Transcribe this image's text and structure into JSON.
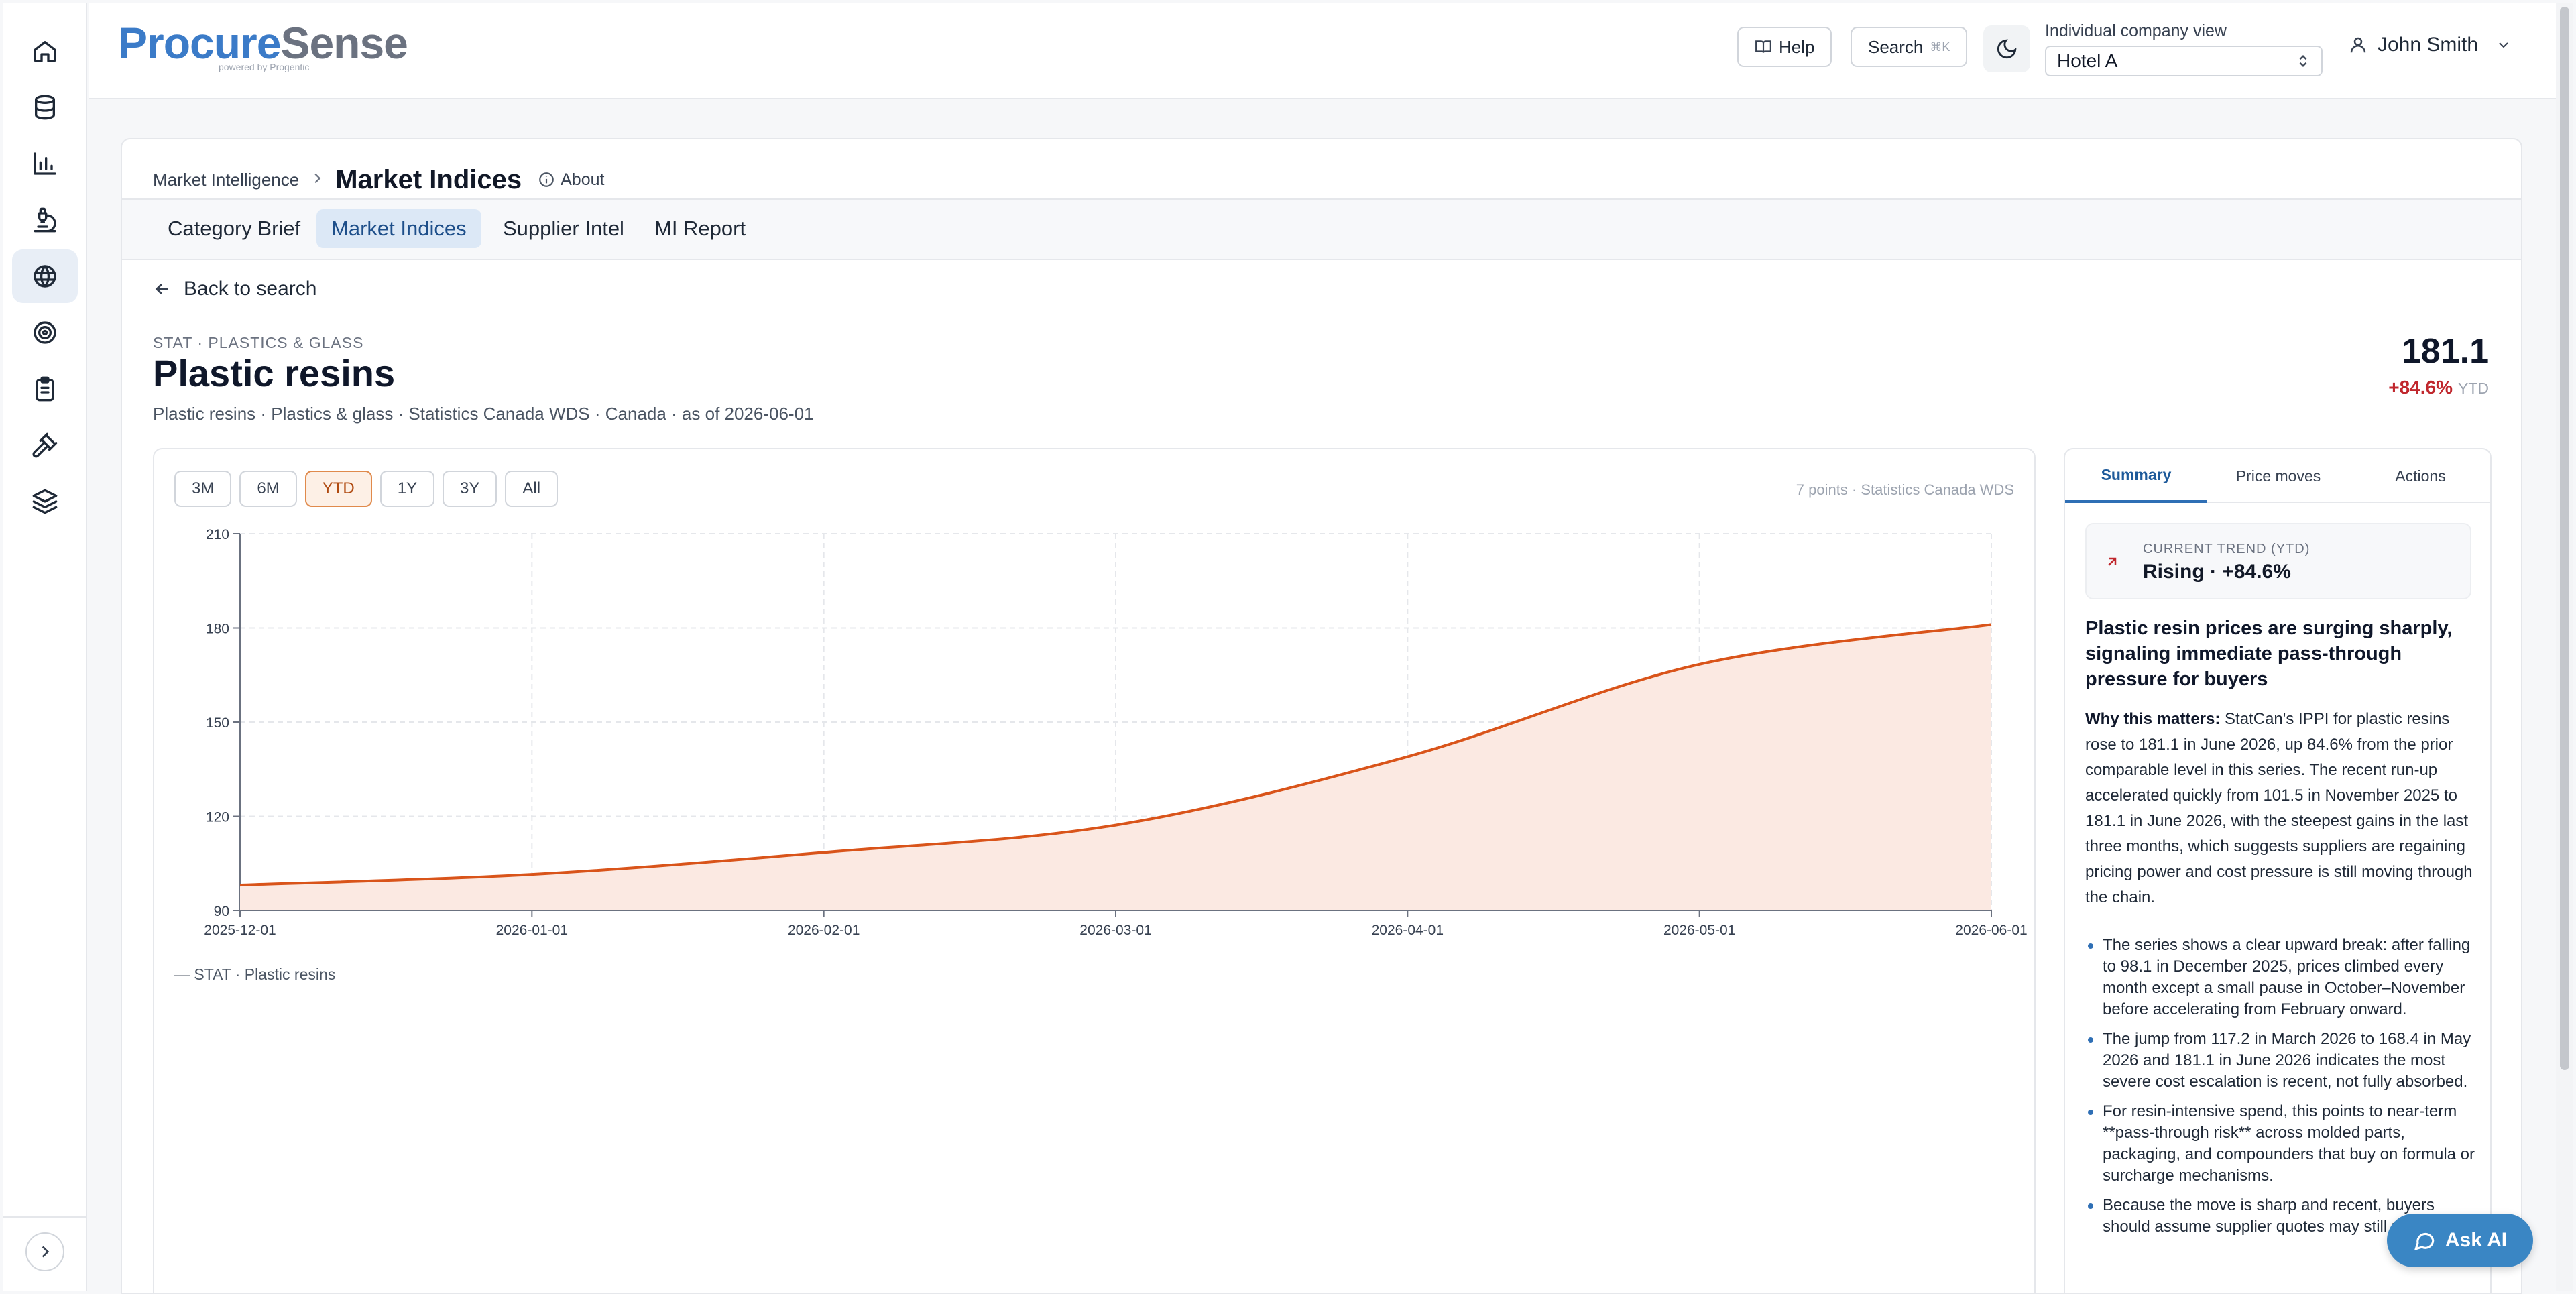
{
  "app": {
    "logo_primary": "Procure",
    "logo_secondary": "Sense",
    "logo_tagline": "powered by Progentic"
  },
  "sidebar": {
    "items": [
      {
        "icon": "home-icon"
      },
      {
        "icon": "database-icon"
      },
      {
        "icon": "bar-chart-icon"
      },
      {
        "icon": "microscope-icon"
      },
      {
        "icon": "globe-icon",
        "active": true
      },
      {
        "icon": "target-icon"
      },
      {
        "icon": "clipboard-icon"
      },
      {
        "icon": "gavel-icon"
      },
      {
        "icon": "layers-icon"
      }
    ],
    "expand_icon": "chevron-right-icon"
  },
  "header": {
    "help_label": "Help",
    "search_label": "Search",
    "search_shortcut": "⌘K",
    "company_label": "Individual company view",
    "company_value": "Hotel A",
    "user_name": "John Smith"
  },
  "breadcrumb": {
    "parent": "Market Intelligence",
    "current": "Market Indices",
    "about": "About"
  },
  "tabs": [
    {
      "label": "Category Brief"
    },
    {
      "label": "Market Indices",
      "active": true
    },
    {
      "label": "Supplier Intel"
    },
    {
      "label": "MI Report"
    }
  ],
  "detail": {
    "back_label": "Back to search",
    "eyebrow": "STAT · PLASTICS & GLASS",
    "title": "Plastic resins",
    "meta": "Plastic resins · Plastics & glass · Statistics Canada WDS · Canada · as of 2026-06-01",
    "value": "181.1",
    "change": "+84.6%",
    "change_period": "YTD"
  },
  "ranges": [
    {
      "label": "3M"
    },
    {
      "label": "6M"
    },
    {
      "label": "YTD",
      "active": true
    },
    {
      "label": "1Y"
    },
    {
      "label": "3Y"
    },
    {
      "label": "All"
    }
  ],
  "chart_meta": "7 points · Statistics Canada WDS",
  "chart_data": {
    "type": "area",
    "x": [
      "2025-12-01",
      "2026-01-01",
      "2026-02-01",
      "2026-03-01",
      "2026-04-01",
      "2026-05-01",
      "2026-06-01"
    ],
    "series": [
      {
        "name": "STAT · Plastic resins",
        "values": [
          98.1,
          101.5,
          108.5,
          117.2,
          139.0,
          168.4,
          181.1
        ]
      }
    ],
    "yticks": [
      90,
      120,
      150,
      180,
      210
    ],
    "ylim": [
      90,
      210
    ],
    "grid": true,
    "line_color": "#d9541a",
    "fill_color": "#fbe9e2",
    "legend_label": "— STAT · Plastic resins",
    "legend_position": "bottom-left"
  },
  "side": {
    "tabs": [
      {
        "label": "Summary",
        "active": true
      },
      {
        "label": "Price moves"
      },
      {
        "label": "Actions"
      }
    ],
    "trend_label": "CURRENT TREND (YTD)",
    "trend_value": "Rising · +84.6%",
    "headline": "Plastic resin prices are surging sharply, signaling immediate pass-through pressure for buyers",
    "why_label": "Why this matters:",
    "why_text": " StatCan's IPPI for plastic resins rose to 181.1 in June 2026, up 84.6% from the prior comparable level in this series. The recent run-up accelerated quickly from 101.5 in November 2025 to 181.1 in June 2026, with the steepest gains in the last three months, which suggests suppliers are regaining pricing power and cost pressure is still moving through the chain.",
    "bullets": [
      "The series shows a clear upward break: after falling to 98.1 in December 2025, prices climbed every month except a small pause in October–November before accelerating from February onward.",
      "The jump from 117.2 in March 2026 to 168.4 in May 2026 and 181.1 in June 2026 indicates the most severe cost escalation is recent, not fully absorbed.",
      "For resin-intensive spend, this points to near-term **pass-through risk** across molded parts, packaging, and compounders that buy on formula or surcharge mechanisms.",
      "Because the move is sharp and recent, buyers should assume supplier quotes may still reprice"
    ]
  },
  "ask_ai_label": "Ask AI"
}
